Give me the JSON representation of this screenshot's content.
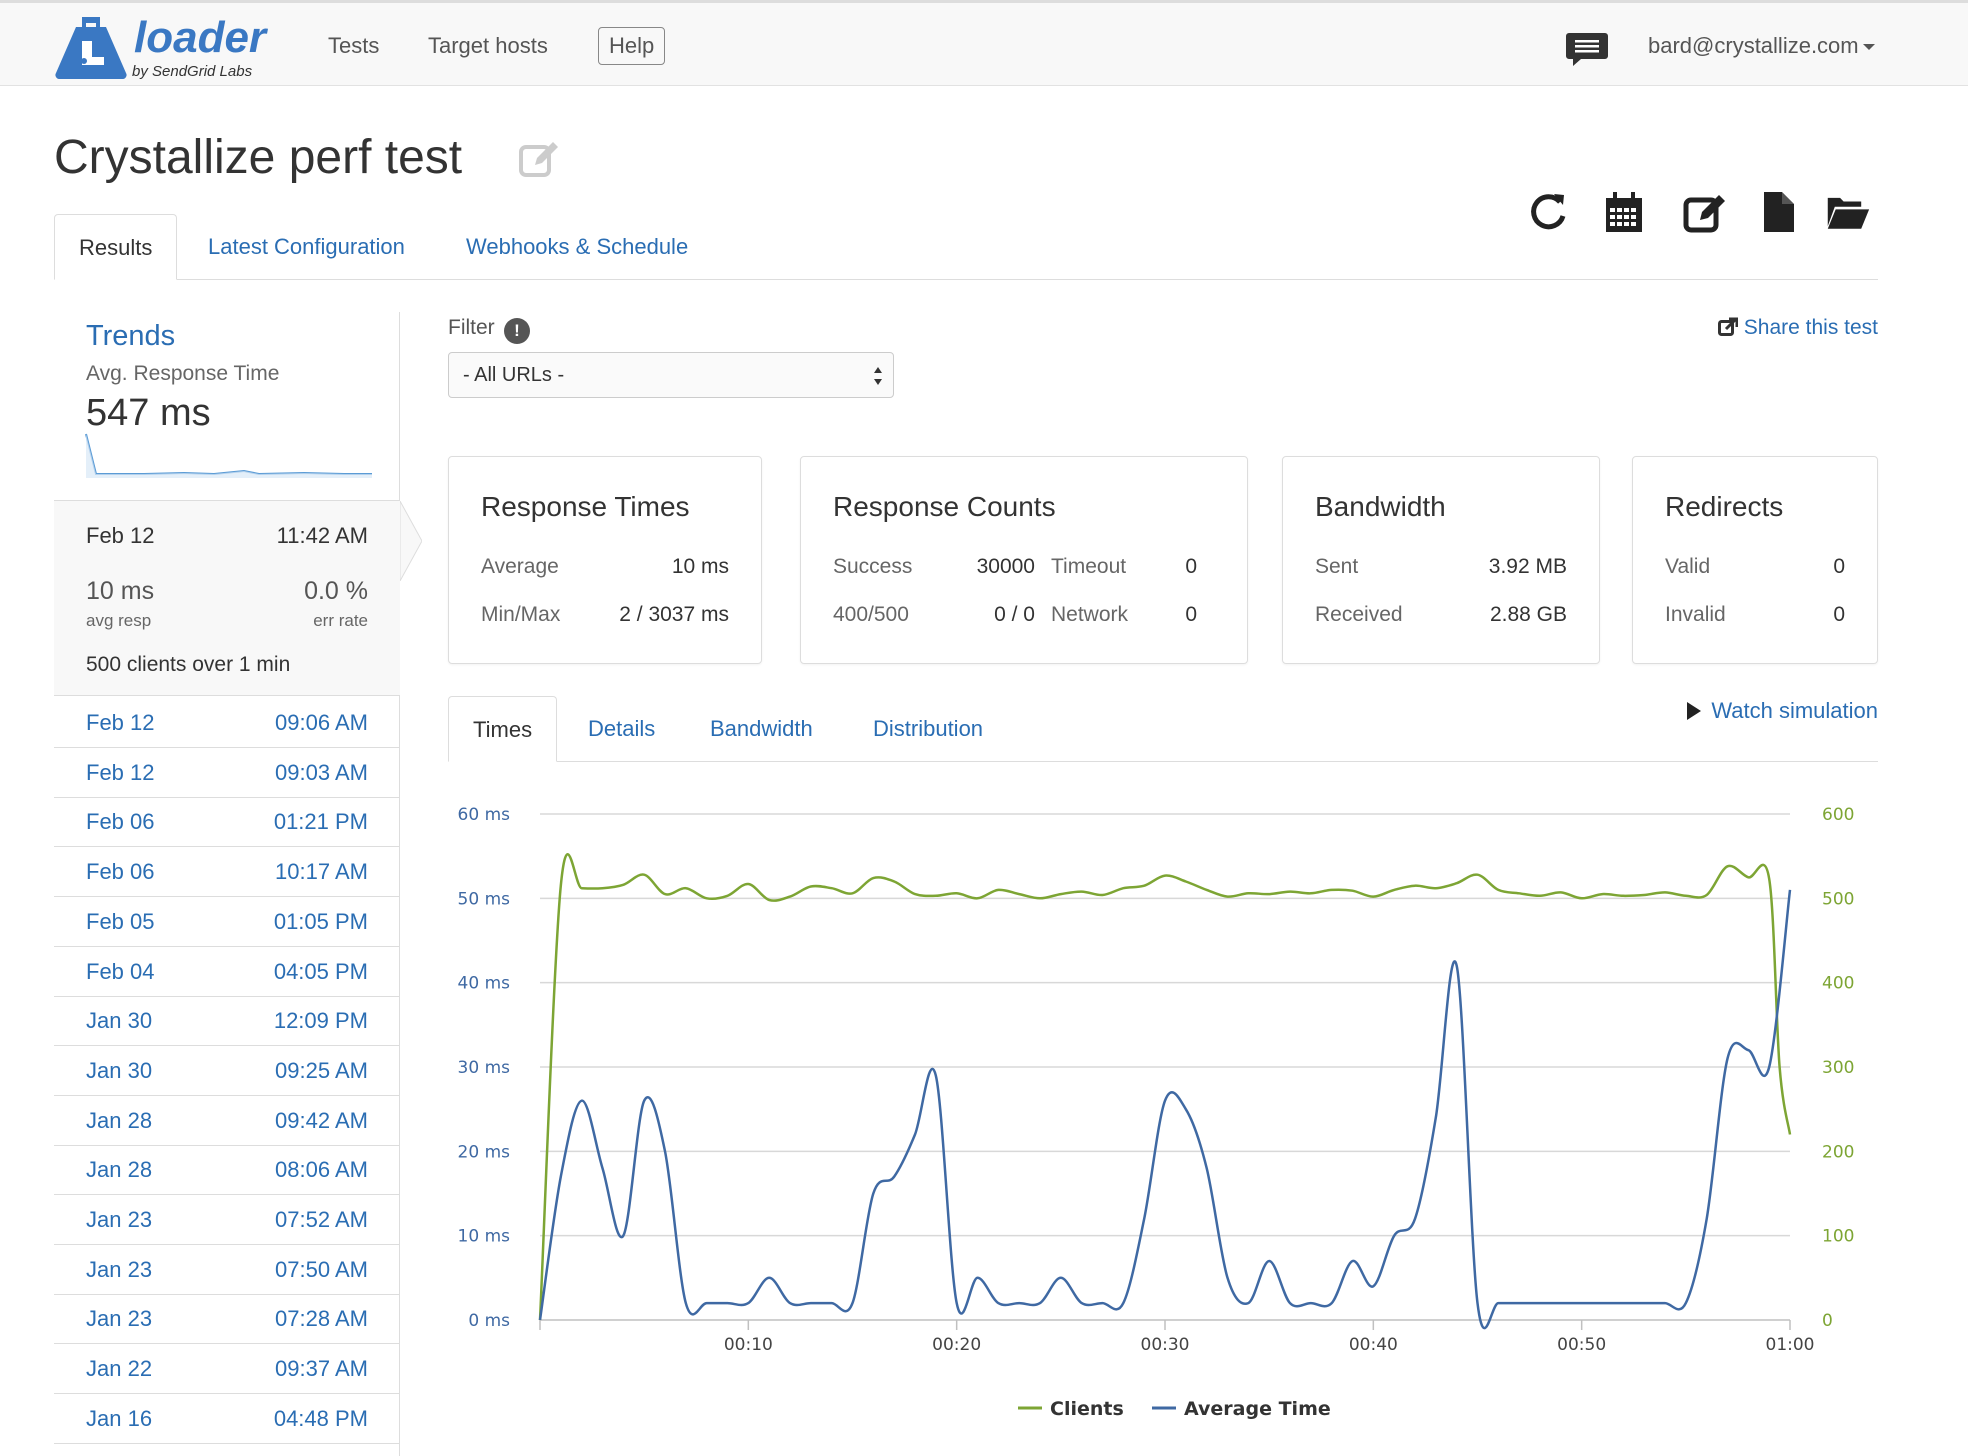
{
  "header": {
    "logo_word": "loader",
    "logo_sub": "by SendGrid Labs",
    "nav": [
      "Tests",
      "Target hosts"
    ],
    "help_label": "Help",
    "user": "bard@crystallize.com"
  },
  "page": {
    "title": "Crystallize perf test"
  },
  "tabs": [
    "Results",
    "Latest Configuration",
    "Webhooks & Schedule"
  ],
  "sidebar": {
    "trends_title": "Trends",
    "trends_label": "Avg. Response Time",
    "trends_value": "547 ms",
    "current": {
      "date": "Feb 12",
      "time": "11:42 AM",
      "avg_resp": "10 ms",
      "avg_resp_label": "avg resp",
      "err_rate": "0.0 %",
      "err_rate_label": "err rate",
      "clients_text": "500 clients over 1 min"
    },
    "runs": [
      {
        "date": "Feb 12",
        "time": "09:06 AM"
      },
      {
        "date": "Feb 12",
        "time": "09:03 AM"
      },
      {
        "date": "Feb 06",
        "time": "01:21 PM"
      },
      {
        "date": "Feb 06",
        "time": "10:17 AM"
      },
      {
        "date": "Feb 05",
        "time": "01:05 PM"
      },
      {
        "date": "Feb 04",
        "time": "04:05 PM"
      },
      {
        "date": "Jan 30",
        "time": "12:09 PM"
      },
      {
        "date": "Jan 30",
        "time": "09:25 AM"
      },
      {
        "date": "Jan 28",
        "time": "09:42 AM"
      },
      {
        "date": "Jan 28",
        "time": "08:06 AM"
      },
      {
        "date": "Jan 23",
        "time": "07:52 AM"
      },
      {
        "date": "Jan 23",
        "time": "07:50 AM"
      },
      {
        "date": "Jan 23",
        "time": "07:28 AM"
      },
      {
        "date": "Jan 22",
        "time": "09:37 AM"
      },
      {
        "date": "Jan 16",
        "time": "04:48 PM"
      }
    ]
  },
  "filter": {
    "label": "Filter",
    "info_glyph": "!",
    "selected": "- All URLs -"
  },
  "share_label": "Share this test",
  "panels": {
    "response_times": {
      "title": "Response Times",
      "average_label": "Average",
      "average": "10 ms",
      "minmax_label": "Min/Max",
      "minmax": "2 / 3037 ms"
    },
    "response_counts": {
      "title": "Response Counts",
      "success_label": "Success",
      "success": "30000",
      "timeout_label": "Timeout",
      "timeout": "0",
      "http_label": "400/500",
      "http": "0 / 0",
      "network_label": "Network",
      "network": "0"
    },
    "bandwidth": {
      "title": "Bandwidth",
      "sent_label": "Sent",
      "sent": "3.92 MB",
      "received_label": "Received",
      "received": "2.88 GB"
    },
    "redirects": {
      "title": "Redirects",
      "valid_label": "Valid",
      "valid": "0",
      "invalid_label": "Invalid",
      "invalid": "0"
    }
  },
  "chart_tabs": [
    "Times",
    "Details",
    "Bandwidth",
    "Distribution"
  ],
  "watch_label": "Watch simulation",
  "colors": {
    "clients": "#7da534",
    "average_time": "#3f69a3",
    "link": "#2a6db3"
  },
  "chart_data": {
    "type": "line",
    "x_ticks": [
      "00:10",
      "00:20",
      "00:30",
      "00:40",
      "00:50",
      "01:00"
    ],
    "xlim": [
      0,
      60
    ],
    "y_left_ticks": [
      "0 ms",
      "10 ms",
      "20 ms",
      "30 ms",
      "40 ms",
      "50 ms",
      "60 ms"
    ],
    "y_left_lim": [
      0,
      60
    ],
    "y_right_ticks": [
      "0",
      "100",
      "200",
      "300",
      "400",
      "500",
      "600"
    ],
    "y_right_lim": [
      0,
      600
    ],
    "grid": true,
    "legend_position": "bottom",
    "series": [
      {
        "name": "Clients",
        "axis": "right",
        "x": [
          0,
          1,
          2,
          3,
          4,
          5,
          6,
          7,
          8,
          9,
          10,
          11,
          12,
          13,
          14,
          15,
          16,
          17,
          18,
          19,
          20,
          21,
          22,
          23,
          24,
          25,
          26,
          27,
          28,
          29,
          30,
          31,
          32,
          33,
          34,
          35,
          36,
          37,
          38,
          39,
          40,
          41,
          42,
          43,
          44,
          45,
          46,
          47,
          48,
          49,
          50,
          51,
          52,
          53,
          54,
          55,
          56,
          57,
          58,
          59,
          59.5,
          60
        ],
        "y": [
          0,
          515,
          512,
          512,
          516,
          528,
          505,
          512,
          500,
          503,
          517,
          498,
          502,
          514,
          512,
          506,
          524,
          520,
          505,
          503,
          506,
          500,
          510,
          505,
          500,
          505,
          508,
          504,
          512,
          515,
          527,
          520,
          510,
          502,
          506,
          505,
          508,
          506,
          510,
          509,
          502,
          510,
          515,
          512,
          518,
          528,
          510,
          506,
          503,
          507,
          500,
          505,
          503,
          504,
          507,
          503,
          504,
          538,
          525,
          523,
          300,
          220
        ]
      },
      {
        "name": "Average Time",
        "axis": "left",
        "x": [
          0,
          1,
          2,
          3,
          4,
          5,
          6,
          7,
          8,
          9,
          10,
          11,
          12,
          13,
          14,
          15,
          16,
          17,
          18,
          19,
          20,
          21,
          22,
          23,
          24,
          25,
          26,
          27,
          28,
          29,
          30,
          31,
          32,
          33,
          34,
          35,
          36,
          37,
          38,
          39,
          40,
          41,
          42,
          43,
          44,
          45,
          46,
          47,
          48,
          49,
          50,
          51,
          52,
          53,
          54,
          55,
          56,
          57,
          58,
          59,
          60
        ],
        "y": [
          0,
          17,
          26,
          18,
          10,
          26,
          20,
          2,
          2,
          2,
          2,
          5,
          2,
          2,
          2,
          2,
          15,
          17,
          22,
          29,
          2,
          5,
          2,
          2,
          2,
          5,
          2,
          2,
          2,
          12,
          26,
          25,
          18,
          5,
          2,
          7,
          2,
          2,
          2,
          7,
          4,
          10,
          12,
          24,
          42,
          2,
          2,
          2,
          2,
          2,
          2,
          2,
          2,
          2,
          2,
          2,
          12,
          31,
          32,
          30,
          51
        ]
      }
    ]
  }
}
